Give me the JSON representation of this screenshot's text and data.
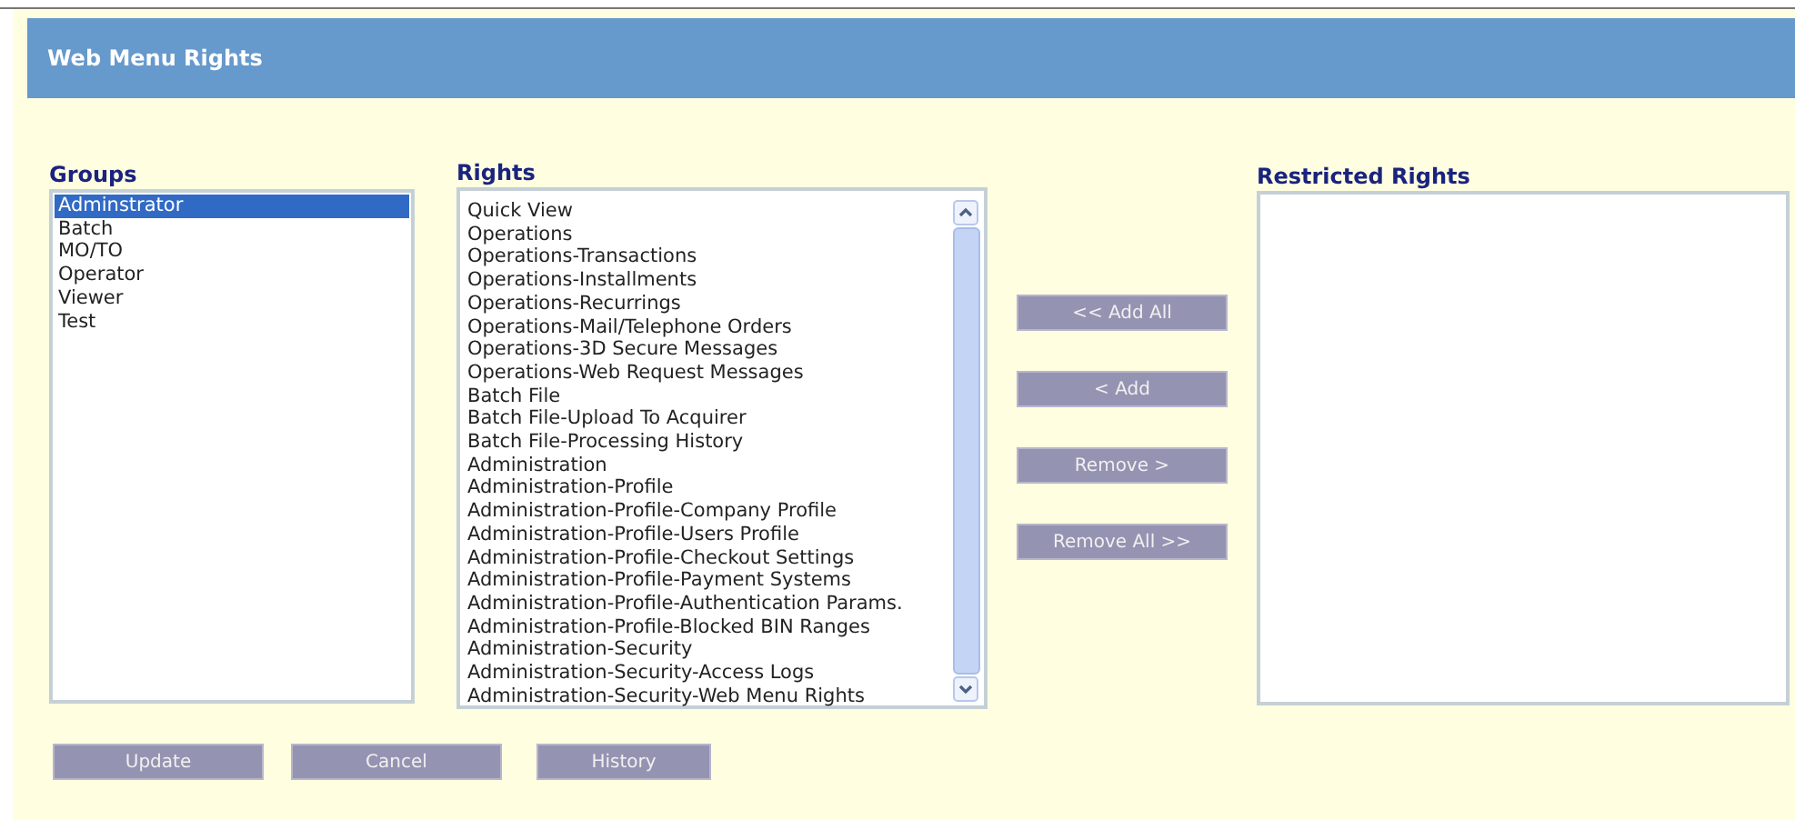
{
  "header": {
    "title": "Web Menu Rights"
  },
  "groups": {
    "label": "Groups",
    "items": [
      {
        "label": "Adminstrator",
        "selected": true
      },
      {
        "label": "Batch",
        "selected": false
      },
      {
        "label": "MO/TO",
        "selected": false
      },
      {
        "label": "Operator",
        "selected": false
      },
      {
        "label": "Viewer",
        "selected": false
      },
      {
        "label": "Test",
        "selected": false
      }
    ]
  },
  "rights": {
    "label": "Rights",
    "items": [
      {
        "label": "Quick View",
        "selected": false
      },
      {
        "label": "Operations",
        "selected": false
      },
      {
        "label": "Operations-Transactions",
        "selected": false
      },
      {
        "label": "Operations-Installments",
        "selected": false
      },
      {
        "label": "Operations-Recurrings",
        "selected": false
      },
      {
        "label": "Operations-Mail/Telephone Orders",
        "selected": false
      },
      {
        "label": "Operations-3D Secure Messages",
        "selected": false
      },
      {
        "label": "Operations-Web Request Messages",
        "selected": false
      },
      {
        "label": "Batch File",
        "selected": false
      },
      {
        "label": "Batch File-Upload To Acquirer",
        "selected": false
      },
      {
        "label": "Batch File-Processing History",
        "selected": false
      },
      {
        "label": "Administration",
        "selected": false
      },
      {
        "label": "Administration-Profile",
        "selected": false
      },
      {
        "label": "Administration-Profile-Company Profile",
        "selected": false
      },
      {
        "label": "Administration-Profile-Users Profile",
        "selected": false
      },
      {
        "label": "Administration-Profile-Checkout Settings",
        "selected": false
      },
      {
        "label": "Administration-Profile-Payment Systems",
        "selected": false
      },
      {
        "label": "Administration-Profile-Authentication Params.",
        "selected": false
      },
      {
        "label": "Administration-Profile-Blocked BIN Ranges",
        "selected": false
      },
      {
        "label": "Administration-Security",
        "selected": false
      },
      {
        "label": "Administration-Security-Access Logs",
        "selected": false
      },
      {
        "label": "Administration-Security-Web Menu Rights",
        "selected": false
      }
    ]
  },
  "transfer_buttons": [
    "<< Add All",
    "< Add",
    "Remove >",
    "Remove All >>"
  ],
  "restricted": {
    "label": "Restricted Rights"
  },
  "footer_buttons": [
    "Update",
    "Cancel",
    "History"
  ]
}
